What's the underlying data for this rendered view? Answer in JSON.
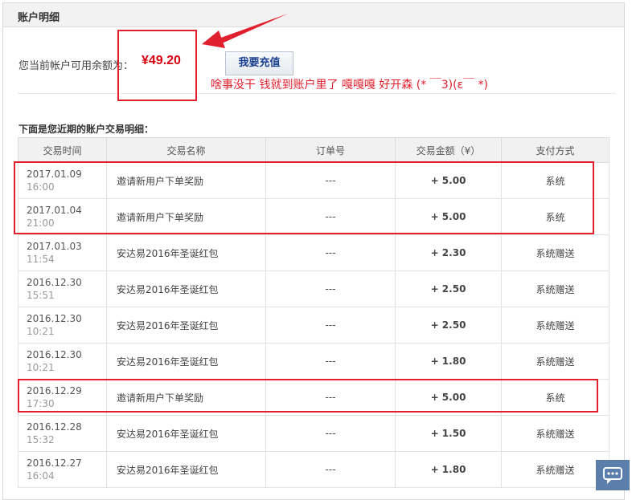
{
  "panel": {
    "title": "账户明细"
  },
  "balance": {
    "label": "您当前帐户可用余额为：",
    "value": "¥49.20",
    "recharge_label": "我要充值"
  },
  "annotation": {
    "text": "啥事没干   钱就到账户里了  嘎嘎嘎  好开森 (* ￣3)(ε￣ *)"
  },
  "transactions": {
    "heading": "下面是您近期的账户交易明细：",
    "columns": [
      "交易时间",
      "交易名称",
      "订单号",
      "交易金额（¥）",
      "支付方式"
    ],
    "rows": [
      {
        "date": "2017.01.09",
        "time": "16:00",
        "name": "邀请新用户下单奖励",
        "order": "---",
        "amount": "+ 5.00",
        "method": "系统"
      },
      {
        "date": "2017.01.04",
        "time": "21:00",
        "name": "邀请新用户下单奖励",
        "order": "---",
        "amount": "+ 5.00",
        "method": "系统"
      },
      {
        "date": "2017.01.03",
        "time": "11:54",
        "name": "安达易2016年圣诞红包",
        "order": "---",
        "amount": "+ 2.30",
        "method": "系统赠送"
      },
      {
        "date": "2016.12.30",
        "time": "15:51",
        "name": "安达易2016年圣诞红包",
        "order": "---",
        "amount": "+ 2.50",
        "method": "系统赠送"
      },
      {
        "date": "2016.12.30",
        "time": "10:21",
        "name": "安达易2016年圣诞红包",
        "order": "---",
        "amount": "+ 2.50",
        "method": "系统赠送"
      },
      {
        "date": "2016.12.30",
        "time": "10:21",
        "name": "安达易2016年圣诞红包",
        "order": "---",
        "amount": "+ 1.80",
        "method": "系统赠送"
      },
      {
        "date": "2016.12.29",
        "time": "17:30",
        "name": "邀请新用户下单奖励",
        "order": "---",
        "amount": "+ 5.00",
        "method": "系统"
      },
      {
        "date": "2016.12.28",
        "time": "15:32",
        "name": "安达易2016年圣诞红包",
        "order": "---",
        "amount": "+ 1.50",
        "method": "系统赠送"
      },
      {
        "date": "2016.12.27",
        "time": "16:04",
        "name": "安达易2016年圣诞红包",
        "order": "---",
        "amount": "+ 1.80",
        "method": "系统赠送"
      }
    ]
  },
  "colors": {
    "accent_red": "#d7000f",
    "amount_green": "#2e9b22",
    "annotation_red": "#e0202e"
  },
  "icons": {
    "chat": "chat-bubble-icon",
    "arrow": "annotation-arrow-icon"
  }
}
